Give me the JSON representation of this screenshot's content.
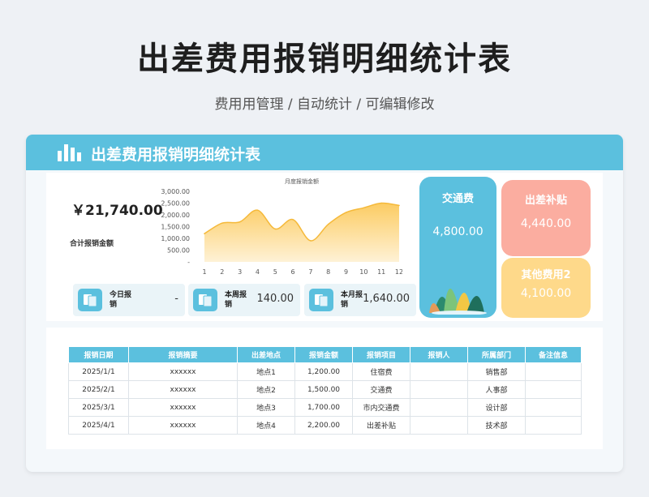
{
  "page": {
    "title": "出差费用报销明细统计表",
    "subtitle": "费用用管理 /  自动统计  /  可编辑修改"
  },
  "dashboard": {
    "header_title": "出差费用报销明细统计表",
    "total_amount": "￥21,740.00",
    "total_label": "合计报销金额",
    "stats": [
      {
        "label": "今日报销",
        "value": "-"
      },
      {
        "label": "本周报销",
        "value": "140.00"
      },
      {
        "label": "本月报销",
        "value": "1,640.00"
      }
    ],
    "tiles": {
      "traffic": {
        "title": "交通费",
        "value": "4,800.00",
        "color": "#5bc0de"
      },
      "trip_allowance": {
        "title": "出差补贴",
        "value": "4,440.00",
        "color": "#fbada0"
      },
      "other": {
        "title": "其他费用2",
        "value": "4,100.00",
        "color": "#fed98a"
      }
    }
  },
  "chart_data": {
    "type": "area",
    "title": "月度报销金额",
    "x": [
      1,
      2,
      3,
      4,
      5,
      6,
      7,
      8,
      9,
      10,
      11,
      12
    ],
    "values": [
      1200,
      1650,
      1700,
      2200,
      1400,
      1800,
      900,
      1600,
      2100,
      2300,
      2500,
      2400
    ],
    "yticks": [
      "3,000.00",
      "2,500.00",
      "2,000.00",
      "1,500.00",
      "1,000.00",
      "500.00",
      "-"
    ],
    "ylim": [
      0,
      3000
    ],
    "color": "#fcc95a",
    "grid": false
  },
  "table": {
    "headers": [
      "报销日期",
      "报销摘要",
      "出差地点",
      "报销金额",
      "报销项目",
      "报销人",
      "所属部门",
      "备注信息"
    ],
    "rows": [
      [
        "2025/1/1",
        "xxxxxx",
        "地点1",
        "1,200.00",
        "住宿费",
        "",
        "销售部",
        ""
      ],
      [
        "2025/2/1",
        "xxxxxx",
        "地点2",
        "1,500.00",
        "交通费",
        "",
        "人事部",
        ""
      ],
      [
        "2025/3/1",
        "xxxxxx",
        "地点3",
        "1,700.00",
        "市内交通费",
        "",
        "设计部",
        ""
      ],
      [
        "2025/4/1",
        "xxxxxx",
        "地点4",
        "2,200.00",
        "出差补贴",
        "",
        "技术部",
        ""
      ]
    ]
  }
}
